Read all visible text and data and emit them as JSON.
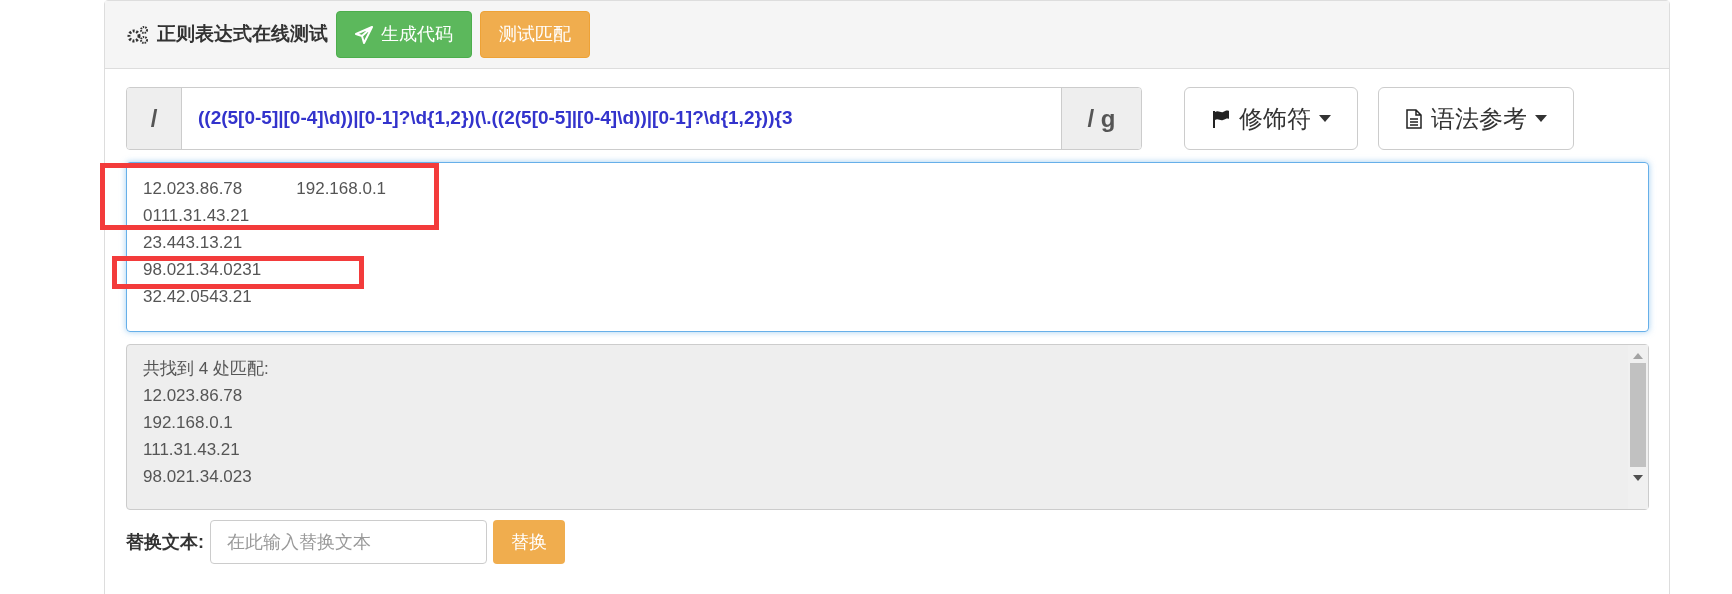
{
  "header": {
    "title": "正则表达式在线测试",
    "buttons": [
      {
        "label": "生成代码",
        "kind": "generate"
      },
      {
        "label": "测试匹配",
        "kind": "test"
      }
    ]
  },
  "regex": {
    "prefix": "/",
    "value": "((2(5[0-5]|[0-4]\\d))|[0-1]?\\d{1,2})(\\.((2(5[0-5]|[0-4]\\d))|[0-1]?\\d{1,2})){3",
    "suffix": "/ g"
  },
  "dropdowns": [
    {
      "label": "修饰符",
      "kind": "flag"
    },
    {
      "label": "语法参考",
      "kind": "doc"
    }
  ],
  "input_lines": [
    [
      "12.023.86.78",
      "192.168.0.1"
    ],
    [
      "0111.31.43.21"
    ],
    [
      "23.443.13.21"
    ],
    [
      "98.021.34.0231"
    ],
    [
      "32.42.0543.21"
    ]
  ],
  "result": {
    "summary": "共找到 4 处匹配:",
    "matches": [
      "12.023.86.78",
      "192.168.0.1",
      "111.31.43.21",
      "98.021.34.023"
    ]
  },
  "replace": {
    "label": "替换文本:",
    "placeholder": "在此输入替换文本",
    "button": "替换"
  }
}
